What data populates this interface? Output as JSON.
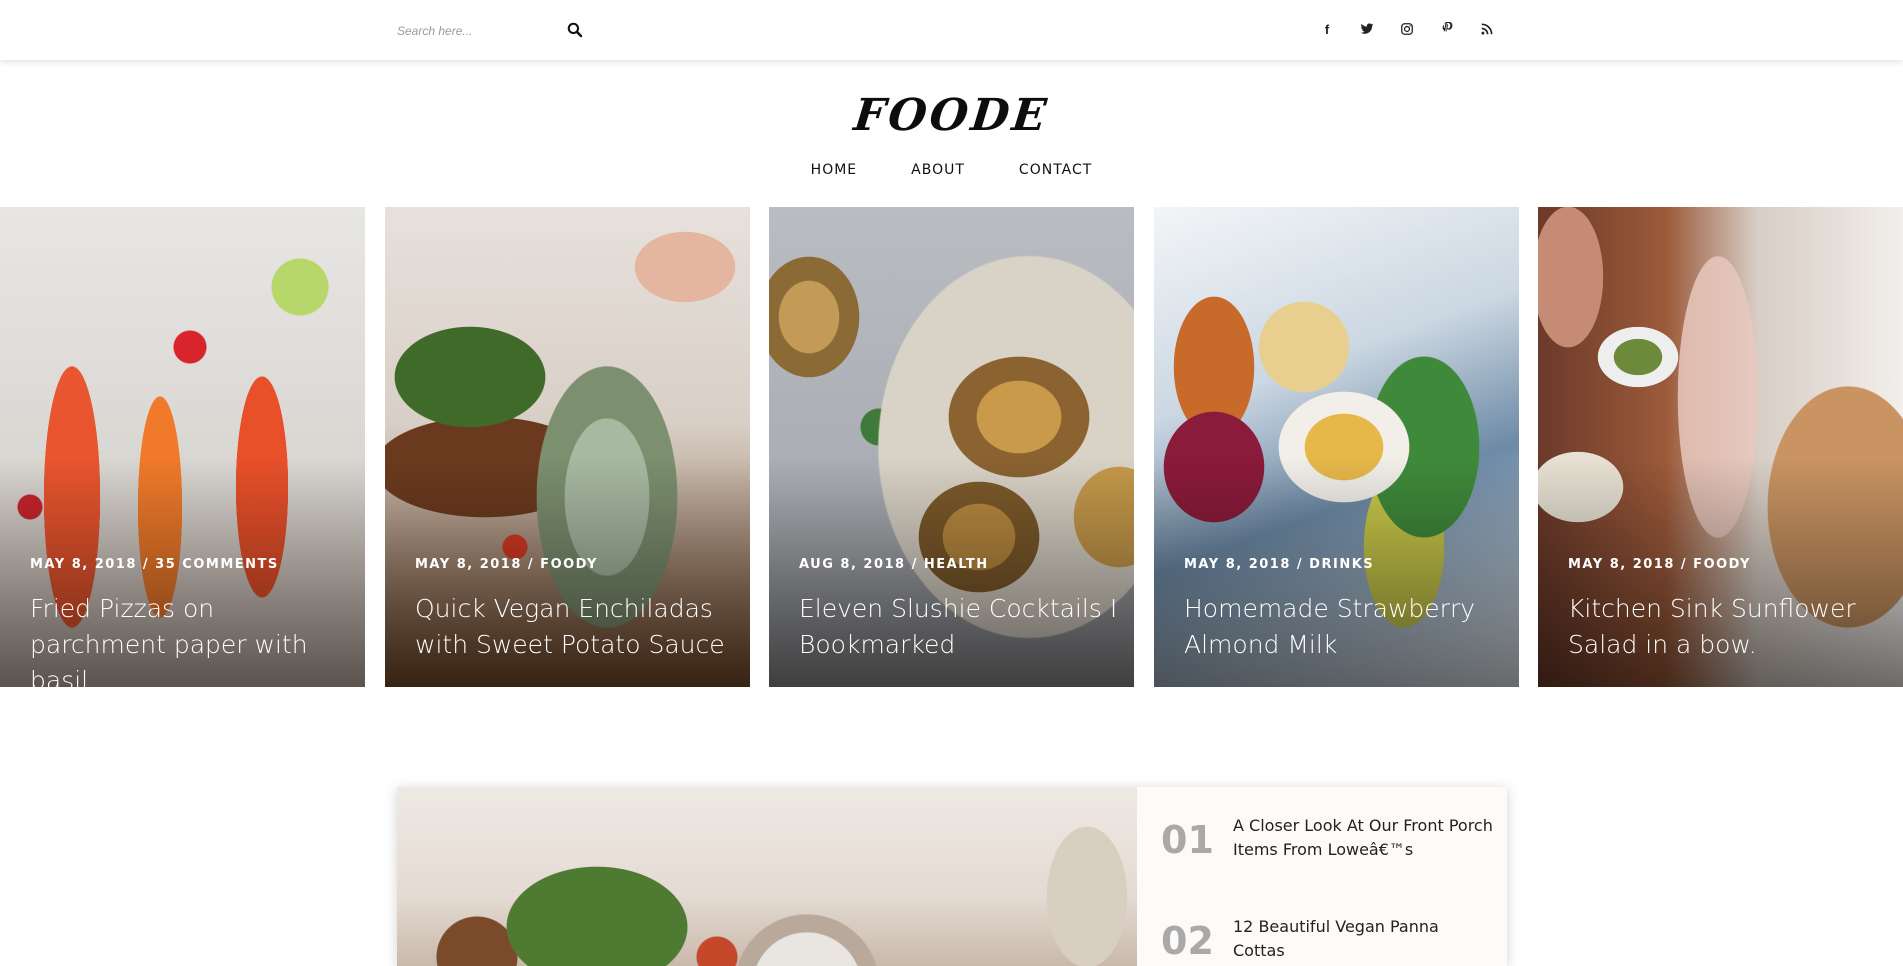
{
  "search": {
    "placeholder": "Search here..."
  },
  "social": {
    "facebook": "f",
    "icons": [
      "facebook-icon",
      "twitter-icon",
      "instagram-icon",
      "pinterest-icon",
      "rss-icon"
    ]
  },
  "logo": "FOODE",
  "nav": [
    {
      "label": "HOME"
    },
    {
      "label": "ABOUT"
    },
    {
      "label": "CONTACT"
    }
  ],
  "cards": [
    {
      "meta": "MAY 8, 2018 / 35 COMMENTS",
      "title": "Fried Pizzas on parchment paper with basil."
    },
    {
      "meta": "MAY 8, 2018 / FOODY",
      "title": "Quick Vegan Enchiladas with Sweet Potato Sauce"
    },
    {
      "meta": "AUG 8, 2018 / HEALTH",
      "title": "Eleven Slushie Cocktails I Bookmarked"
    },
    {
      "meta": "MAY 8, 2018 / DRINKS",
      "title": "Homemade Strawberry Almond Milk"
    },
    {
      "meta": "MAY 8, 2018 / FOODY",
      "title": "Kitchen Sink Sunflower Salad in a bow."
    }
  ],
  "popular": [
    {
      "num": "01",
      "title": "A Closer Look At Our Front Porch Items From Loweâ€™s"
    },
    {
      "num": "02",
      "title": "12 Beautiful Vegan Panna Cottas"
    }
  ],
  "colors": {
    "text": "#111111",
    "muted_number": "#a9a9a9",
    "list_bg": "#fdfaf8"
  }
}
